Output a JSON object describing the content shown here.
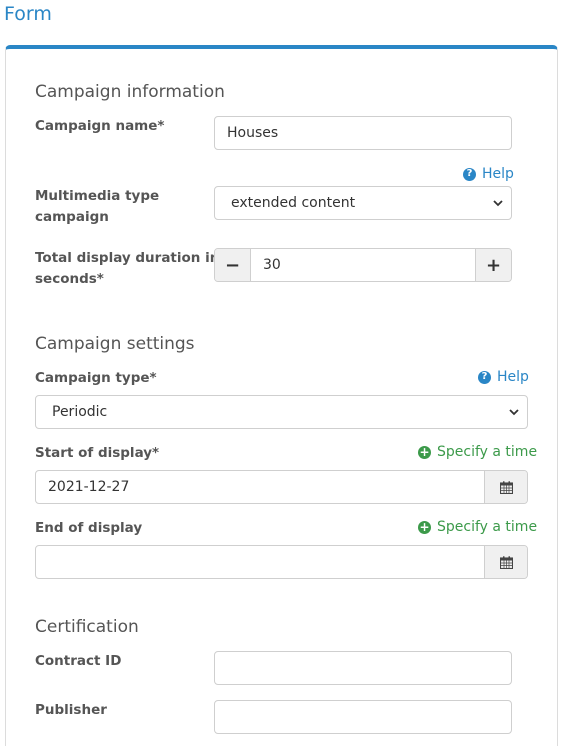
{
  "page": {
    "title": "Form"
  },
  "campaign_info": {
    "section_title": "Campaign information",
    "name_label": "Campaign name*",
    "name_value": "Houses",
    "help_label": "Help",
    "multimedia_label_line1": "Multimedia type",
    "multimedia_label_line2": "campaign",
    "multimedia_value": "extended content",
    "duration_label_line1": "Total display duration in",
    "duration_label_line2": "seconds*",
    "duration_value": "30",
    "minus_symbol": "−",
    "plus_symbol": "+"
  },
  "campaign_settings": {
    "section_title": "Campaign settings",
    "type_label": "Campaign type*",
    "help_label": "Help",
    "type_value": "Periodic",
    "start_label": "Start of display*",
    "start_value": "2021-12-27",
    "start_specify": "Specify a time",
    "end_label": "End of display",
    "end_value": "",
    "end_specify": "Specify a time"
  },
  "certification": {
    "section_title": "Certification",
    "contract_label": "Contract ID",
    "contract_value": "",
    "publisher_label": "Publisher",
    "publisher_value": ""
  },
  "colors": {
    "accent": "#2a86c6",
    "success": "#3c9a4a",
    "label": "#555555"
  },
  "icons": {
    "help": "question-circle-icon",
    "specify": "plus-circle-icon",
    "calendar": "calendar-icon",
    "select": "chevron-down-icon"
  }
}
